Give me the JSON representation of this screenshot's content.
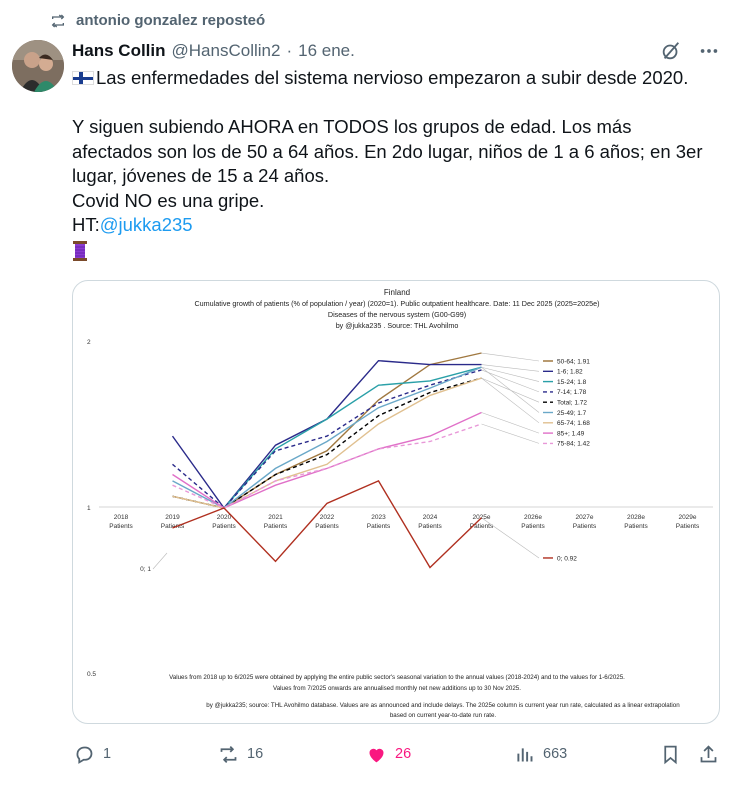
{
  "repost": {
    "text": "antonio gonzalez reposteó"
  },
  "author": {
    "name": "Hans Collin",
    "handle": "@HansCollin2",
    "separator": "·",
    "date": "16 ene."
  },
  "tweet": {
    "line1": "Las enfermedades del sistema nervioso empezaron a subir desde 2020.",
    "line2": "Y siguen subiendo AHORA en TODOS los grupos de edad. Los más afectados son los de 50 a 64 años. En 2do lugar, niños de 1 a 6 años; en 3er lugar, jóvenes de 15 a 24 años.",
    "line3": "Covid NO es una gripe.",
    "ht_prefix": "HT:",
    "ht_link": "@jukka235"
  },
  "chart_data": {
    "type": "line",
    "title": "Finland",
    "subtitle": "Cumulative growth of patients (% of population / year) (2020=1).  Public outpatient healthcare. Date: 11 Dec 2025 (2025=2025e)",
    "subtitle2": "Diseases of the nervous system (G00-G99)",
    "subtitle3": "by @jukka235 . Source: THL Avohilmo",
    "categories": [
      "2018",
      "2019",
      "2020",
      "2021",
      "2022",
      "2023",
      "2024",
      "2025e",
      "2026e",
      "2027e",
      "2028e",
      "2029e"
    ],
    "category_sublabel": "Patients",
    "yticks": [
      2,
      1,
      0.5
    ],
    "ylim": [
      0.5,
      2
    ],
    "log_scale": true,
    "series": [
      {
        "name": "50-64",
        "label": "50-64; 1.91",
        "color": "#a07840",
        "dash": "",
        "values": [
          null,
          1.05,
          1.0,
          1.15,
          1.27,
          1.57,
          1.82,
          1.91
        ]
      },
      {
        "name": "1-6",
        "label": "1-6; 1.82",
        "color": "#2a2a8a",
        "dash": "",
        "values": [
          null,
          1.35,
          1.0,
          1.3,
          1.45,
          1.85,
          1.82,
          1.82
        ]
      },
      {
        "name": "15-24",
        "label": "15-24; 1.8",
        "color": "#2aa0a8",
        "dash": "",
        "values": [
          null,
          null,
          1.0,
          1.28,
          1.45,
          1.67,
          1.7,
          1.8
        ]
      },
      {
        "name": "7-14",
        "label": "7-14; 1.78",
        "color": "#2a2a8a",
        "dash": "4,3",
        "values": [
          null,
          1.2,
          1.0,
          1.27,
          1.35,
          1.55,
          1.67,
          1.78
        ]
      },
      {
        "name": "Total",
        "label": "Total; 1.72",
        "color": "#000000",
        "dash": "4,3",
        "values": [
          null,
          1.05,
          1.0,
          1.15,
          1.25,
          1.47,
          1.62,
          1.72
        ]
      },
      {
        "name": "25-49",
        "label": "25-49; 1.7",
        "color": "#6aa8c8",
        "dash": "",
        "values": [
          null,
          1.12,
          1.0,
          1.18,
          1.32,
          1.52,
          1.65,
          1.8
        ]
      },
      {
        "name": "65-74",
        "label": "65-74; 1.68",
        "color": "#e0c090",
        "dash": "",
        "values": [
          null,
          1.05,
          1.0,
          1.12,
          1.2,
          1.42,
          1.6,
          1.72
        ]
      },
      {
        "name": "85+",
        "label": "85+; 1.49",
        "color": "#e070c8",
        "dash": "",
        "values": [
          null,
          1.15,
          1.0,
          1.1,
          1.18,
          1.28,
          1.35,
          1.49
        ]
      },
      {
        "name": "75-84",
        "label": "75-84; 1.42",
        "color": "#e898d8",
        "dash": "4,3",
        "values": [
          null,
          1.1,
          1.0,
          1.12,
          1.18,
          1.28,
          1.32,
          1.42
        ]
      },
      {
        "name": "0",
        "label": "0; 0.92",
        "color": "#b03020",
        "dash": "",
        "values": [
          null,
          0.92,
          1.0,
          0.8,
          1.02,
          1.12,
          0.78,
          0.96
        ]
      }
    ],
    "zero_start_label": "0; 1",
    "footnote1": "Values from 2018 up to 6/2025 were obtained by applying the entire public sector's seasonal variation to the annual values (2018-2024) and to the values for 1-6/2025.",
    "footnote2": "Values from 7/2025 onwards are annualised monthly net new additions up to 30 Nov 2025.",
    "footnote3": "by @jukka235; source: THL Avohilmo database. Values are as announced and include delays. The 2025e column is current year run rate, calculated as a linear extrapolation",
    "footnote4": "based on current year-to-date run rate."
  },
  "actions": {
    "replies": "1",
    "reposts": "16",
    "likes": "26",
    "views": "663"
  },
  "colors": {
    "like": "#f91880",
    "link": "#1d9bf0",
    "muted": "#536471"
  }
}
